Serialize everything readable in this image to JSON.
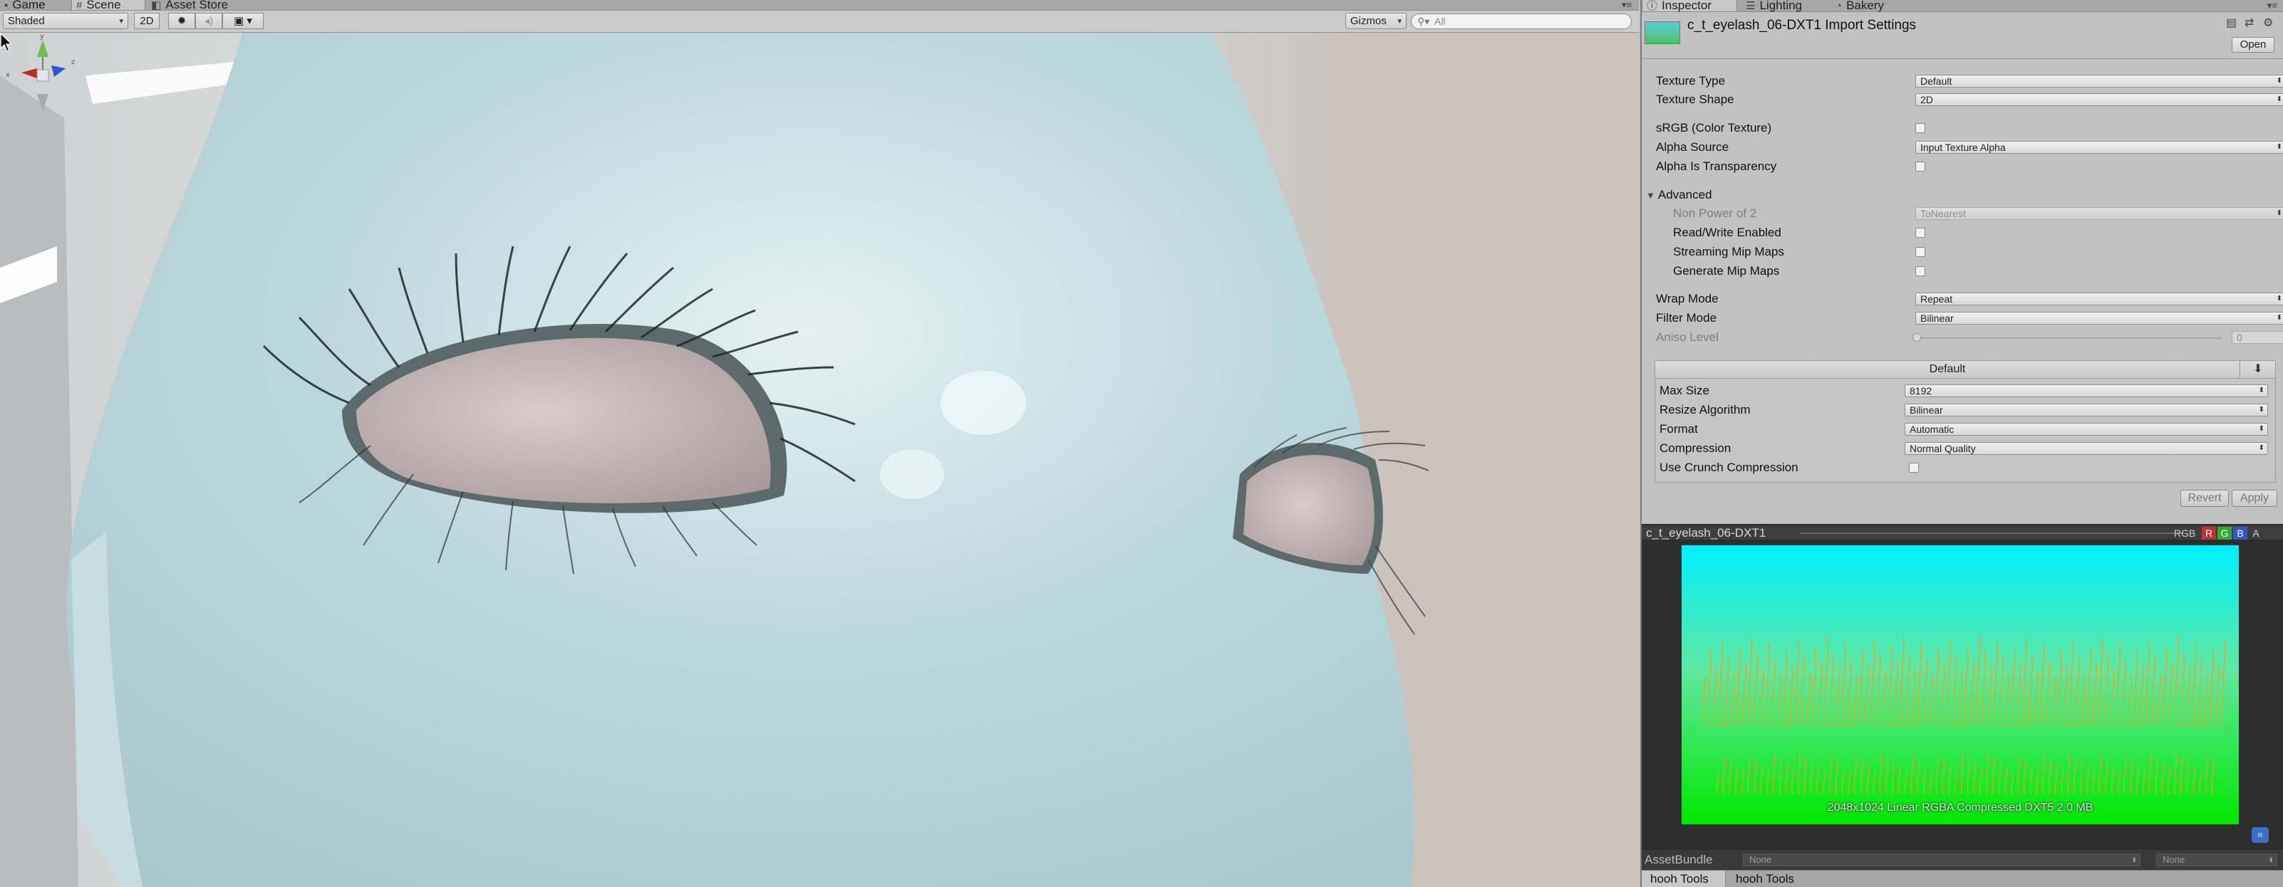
{
  "scene_window": {
    "tabs": [
      {
        "label": "Game",
        "icon": "gamepad-icon"
      },
      {
        "label": "Scene",
        "icon": "grid-icon"
      },
      {
        "label": "Asset Store",
        "icon": "store-icon"
      }
    ],
    "toolbar": {
      "shading_mode": "Shaded",
      "mode_2d": "2D",
      "gizmos_label": "Gizmos",
      "search_placeholder": "All"
    }
  },
  "inspector": {
    "tabs": [
      {
        "label": "Inspector",
        "icon": "info-icon"
      },
      {
        "label": "Lighting",
        "icon": "list-icon"
      },
      {
        "label": "Bakery",
        "icon": "bakery-icon"
      }
    ],
    "asset_title": "c_t_eyelash_06-DXT1 Import Settings",
    "open_button": "Open",
    "properties": {
      "texture_type": {
        "label": "Texture Type",
        "value": "Default"
      },
      "texture_shape": {
        "label": "Texture Shape",
        "value": "2D"
      },
      "srgb": {
        "label": "sRGB (Color Texture)",
        "checked": false
      },
      "alpha_source": {
        "label": "Alpha Source",
        "value": "Input Texture Alpha"
      },
      "alpha_is_transparency": {
        "label": "Alpha Is Transparency",
        "checked": false
      },
      "advanced": {
        "label": "Advanced",
        "expanded": true
      },
      "non_power_of_2": {
        "label": "Non Power of 2",
        "value": "ToNearest"
      },
      "read_write": {
        "label": "Read/Write Enabled",
        "checked": false
      },
      "streaming_mips": {
        "label": "Streaming Mip Maps",
        "checked": false
      },
      "generate_mips": {
        "label": "Generate Mip Maps",
        "checked": false
      },
      "wrap_mode": {
        "label": "Wrap Mode",
        "value": "Repeat"
      },
      "filter_mode": {
        "label": "Filter Mode",
        "value": "Bilinear"
      },
      "aniso_level": {
        "label": "Aniso Level",
        "value": "0"
      }
    },
    "platform": {
      "tab_label": "Default",
      "max_size": {
        "label": "Max Size",
        "value": "8192"
      },
      "resize_algorithm": {
        "label": "Resize Algorithm",
        "value": "Bilinear"
      },
      "format": {
        "label": "Format",
        "value": "Automatic"
      },
      "compression": {
        "label": "Compression",
        "value": "Normal Quality"
      },
      "use_crunch": {
        "label": "Use Crunch Compression",
        "checked": false
      }
    },
    "revert_button": "Revert",
    "apply_button": "Apply"
  },
  "preview": {
    "title": "c_t_eyelash_06-DXT1",
    "channels": [
      "RGB",
      "R",
      "G",
      "B",
      "A"
    ],
    "info": "2048x1024 Linear  RGBA Compressed DXT5   2.0 MB",
    "colors": {
      "top": "#00f0ff",
      "bottom": "#00e800",
      "strands": "#f0a020"
    }
  },
  "asset_bundle": {
    "label": "AssetBundle",
    "bundle_value": "None",
    "variant_value": "None"
  },
  "bottom_tabs": [
    "hooh Tools",
    "hooh Tools"
  ],
  "theme": {
    "skin_color": "#b9d6dc",
    "eye_color": "#c8b8b8",
    "panel_bg": "#c2c2c2"
  }
}
